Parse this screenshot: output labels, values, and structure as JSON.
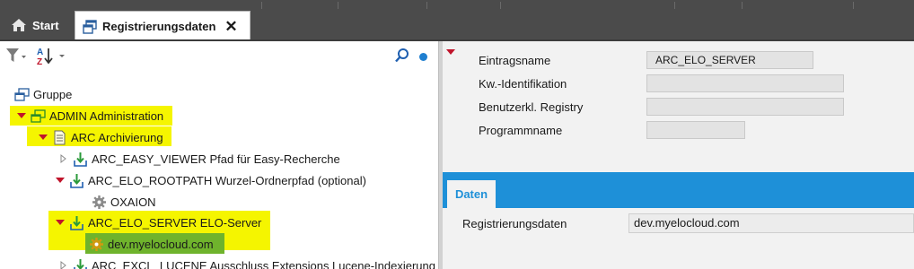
{
  "tabs": {
    "start_label": "Start",
    "active_label": "Registrierungsdaten",
    "close_glyph": "✕"
  },
  "toolbar": {
    "icons": [
      "filter-icon",
      "sort-az-icon",
      "search-icon",
      "status-dot-icon"
    ]
  },
  "tree": {
    "root_label": "Gruppe",
    "items": [
      {
        "label": "ADMIN Administration"
      },
      {
        "label": "ARC Archivierung"
      },
      {
        "label": "ARC_EASY_VIEWER Pfad für Easy-Recherche"
      },
      {
        "label": "ARC_ELO_ROOTPATH Wurzel-Ordnerpfad (optional)"
      },
      {
        "label": "OXAION"
      },
      {
        "label": "ARC_ELO_SERVER ELO-Server"
      },
      {
        "label": "dev.myelocloud.com"
      },
      {
        "label": "ARC_EXCL_LUCENE Ausschluss Extensions Lucene-Indexierung"
      }
    ]
  },
  "details": {
    "fields": [
      {
        "label": "Eintragsname",
        "value": "ARC_ELO_SERVER"
      },
      {
        "label": "Kw.-Identifikation",
        "value": ""
      },
      {
        "label": "Benutzerkl. Registry",
        "value": ""
      },
      {
        "label": "Programmname",
        "value": ""
      }
    ],
    "data_tab_label": "Daten",
    "data_label": "Registrierungsdaten",
    "data_value": "dev.myelocloud.com"
  },
  "colors": {
    "highlight": "#f5f500",
    "selected": "#6fb32c",
    "accent_blue": "#1e90d8",
    "expander_red": "#c0142b"
  }
}
